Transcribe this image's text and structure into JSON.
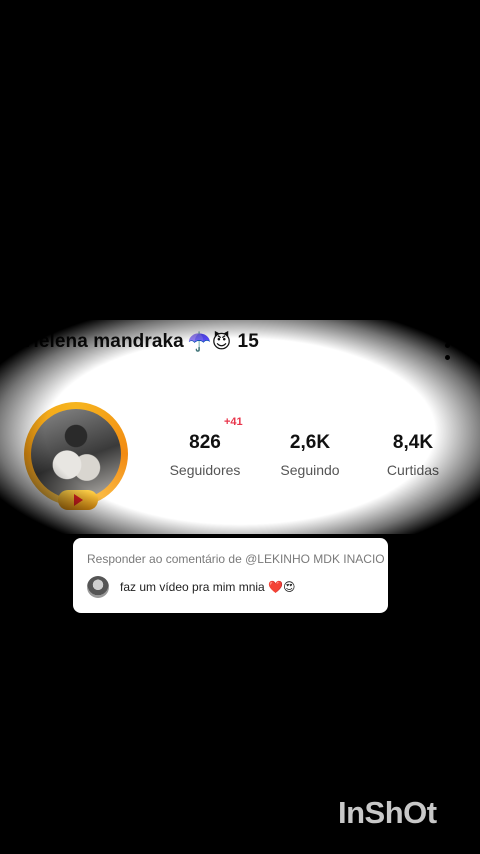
{
  "profile": {
    "name": "Helena  mandraka",
    "name_emojis": "☂️😈",
    "age": "15",
    "stats": {
      "followers_value": "826",
      "followers_label": "Seguidores",
      "followers_delta": "+41",
      "following_value": "2,6K",
      "following_label": "Seguindo",
      "likes_value": "8,4K",
      "likes_label": "Curtidas"
    }
  },
  "reply": {
    "title": "Responder ao comentário de @LEKINHO MDK INACIO",
    "comment_text": "faz um vídeo pra mim mnia",
    "comment_emojis": "❤️😍"
  },
  "watermark": "InShOt",
  "icons": [
    "more-vertical-icon",
    "play-icon"
  ],
  "colors": {
    "accent_delta": "#e8344a",
    "avatar_ring": "#f6b51f"
  }
}
